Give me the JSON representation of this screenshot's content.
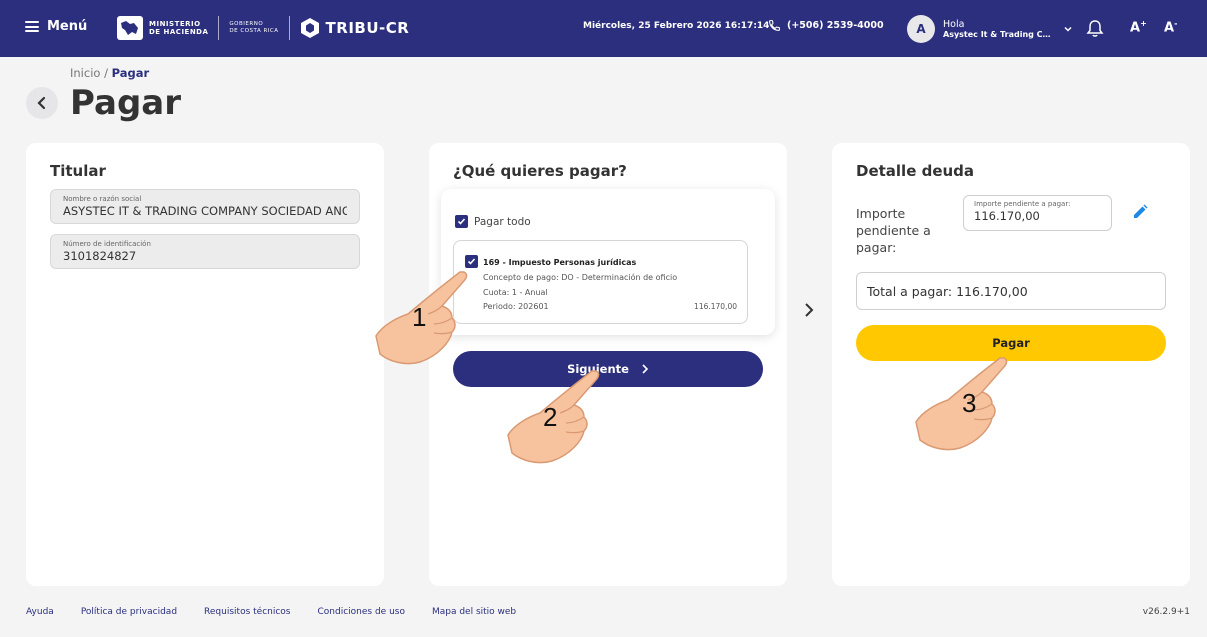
{
  "header": {
    "menu_label": "Menú",
    "ministry_line1": "MINISTERIO",
    "ministry_line2": "DE HACIENDA",
    "gov_line1": "GOBIERNO",
    "gov_line2": "DE COSTA RICA",
    "app_name": "TRIBU-CR",
    "datetime": "Miércoles, 25 Febrero 2026 16:17:14",
    "phone": "(+506) 2539-4000",
    "greeting": "Hola",
    "user_name": "Asystec It & Trading Co...",
    "avatar_initial": "A",
    "font_increase_label": "A",
    "font_increase_sup": "+",
    "font_decrease_label": "A",
    "font_decrease_sup": "-"
  },
  "breadcrumb": {
    "home": "Inicio",
    "separator": " / ",
    "current": "Pagar"
  },
  "page_title": "Pagar",
  "titular": {
    "heading": "Titular",
    "name_label": "Nombre o razón social",
    "name_value": "ASYSTEC IT & TRADING COMPANY  SOCIEDAD ANONIMA",
    "id_label": "Número de identificación",
    "id_value": "3101824827"
  },
  "pay_selection": {
    "heading": "¿Qué quieres pagar?",
    "pay_all_label": "Pagar todo",
    "pay_all_checked": true,
    "item": {
      "checked": true,
      "title": "169 - Impuesto Personas jurídicas",
      "concept": "Concepto de pago: DO - Determinación de oficio",
      "cuota": "Cuota: 1 - Anual",
      "periodo": "Periodo: 202601",
      "amount": "116.170,00"
    },
    "next_button": "Siguiente"
  },
  "detail": {
    "heading": "Detalle deuda",
    "pending_label": "Importe pendiente a pagar:",
    "pending_input_label": "Importe pendiente a pagar:",
    "pending_input_value": "116.170,00",
    "total_text": "Total a pagar: 116.170,00",
    "pay_button": "Pagar"
  },
  "footer": {
    "links": [
      "Ayuda",
      "Política de privacidad",
      "Requisitos técnicos",
      "Condiciones de uso",
      "Mapa del sitio web"
    ],
    "version": "v26.2.9+1"
  },
  "tutorial_steps": [
    "1",
    "2",
    "3"
  ],
  "colors": {
    "primary": "#2b2f7e",
    "accent": "#ffc800",
    "background": "#f4f4f5",
    "edit_icon": "#1e88e5"
  }
}
